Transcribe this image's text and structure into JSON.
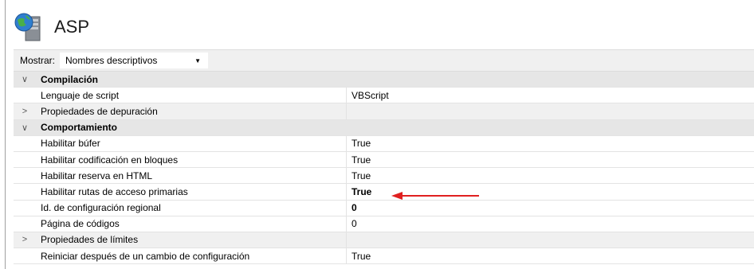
{
  "header": {
    "title": "ASP",
    "icon": "globe-server-icon"
  },
  "toolbar": {
    "mostrar_label": "Mostrar:",
    "mostrar_value": "Nombres descriptivos"
  },
  "rows": [
    {
      "type": "category",
      "expander": "∨",
      "name": "Compilación"
    },
    {
      "type": "prop",
      "name": "Lenguaje de script",
      "value": "VBScript"
    },
    {
      "type": "group",
      "expander": ">",
      "name": "Propiedades de depuración",
      "value": ""
    },
    {
      "type": "category",
      "expander": "∨",
      "name": "Comportamiento"
    },
    {
      "type": "prop",
      "name": "Habilitar búfer",
      "value": "True"
    },
    {
      "type": "prop",
      "name": "Habilitar codificación en bloques",
      "value": "True"
    },
    {
      "type": "prop",
      "name": "Habilitar reserva en HTML",
      "value": "True"
    },
    {
      "type": "prop",
      "name": "Habilitar rutas de acceso primarias",
      "value": "True",
      "bold": true
    },
    {
      "type": "prop",
      "name": "Id. de configuración regional",
      "value": "0",
      "bold": true
    },
    {
      "type": "prop",
      "name": "Página de códigos",
      "value": "0"
    },
    {
      "type": "group",
      "expander": ">",
      "name": "Propiedades de límites",
      "value": ""
    },
    {
      "type": "prop",
      "name": "Reiniciar después de un cambio de configuración",
      "value": "True"
    }
  ],
  "colors": {
    "arrow": "#e02020",
    "category_bg": "#e6e6e6",
    "toolbar_bg": "#f0f0f0"
  }
}
